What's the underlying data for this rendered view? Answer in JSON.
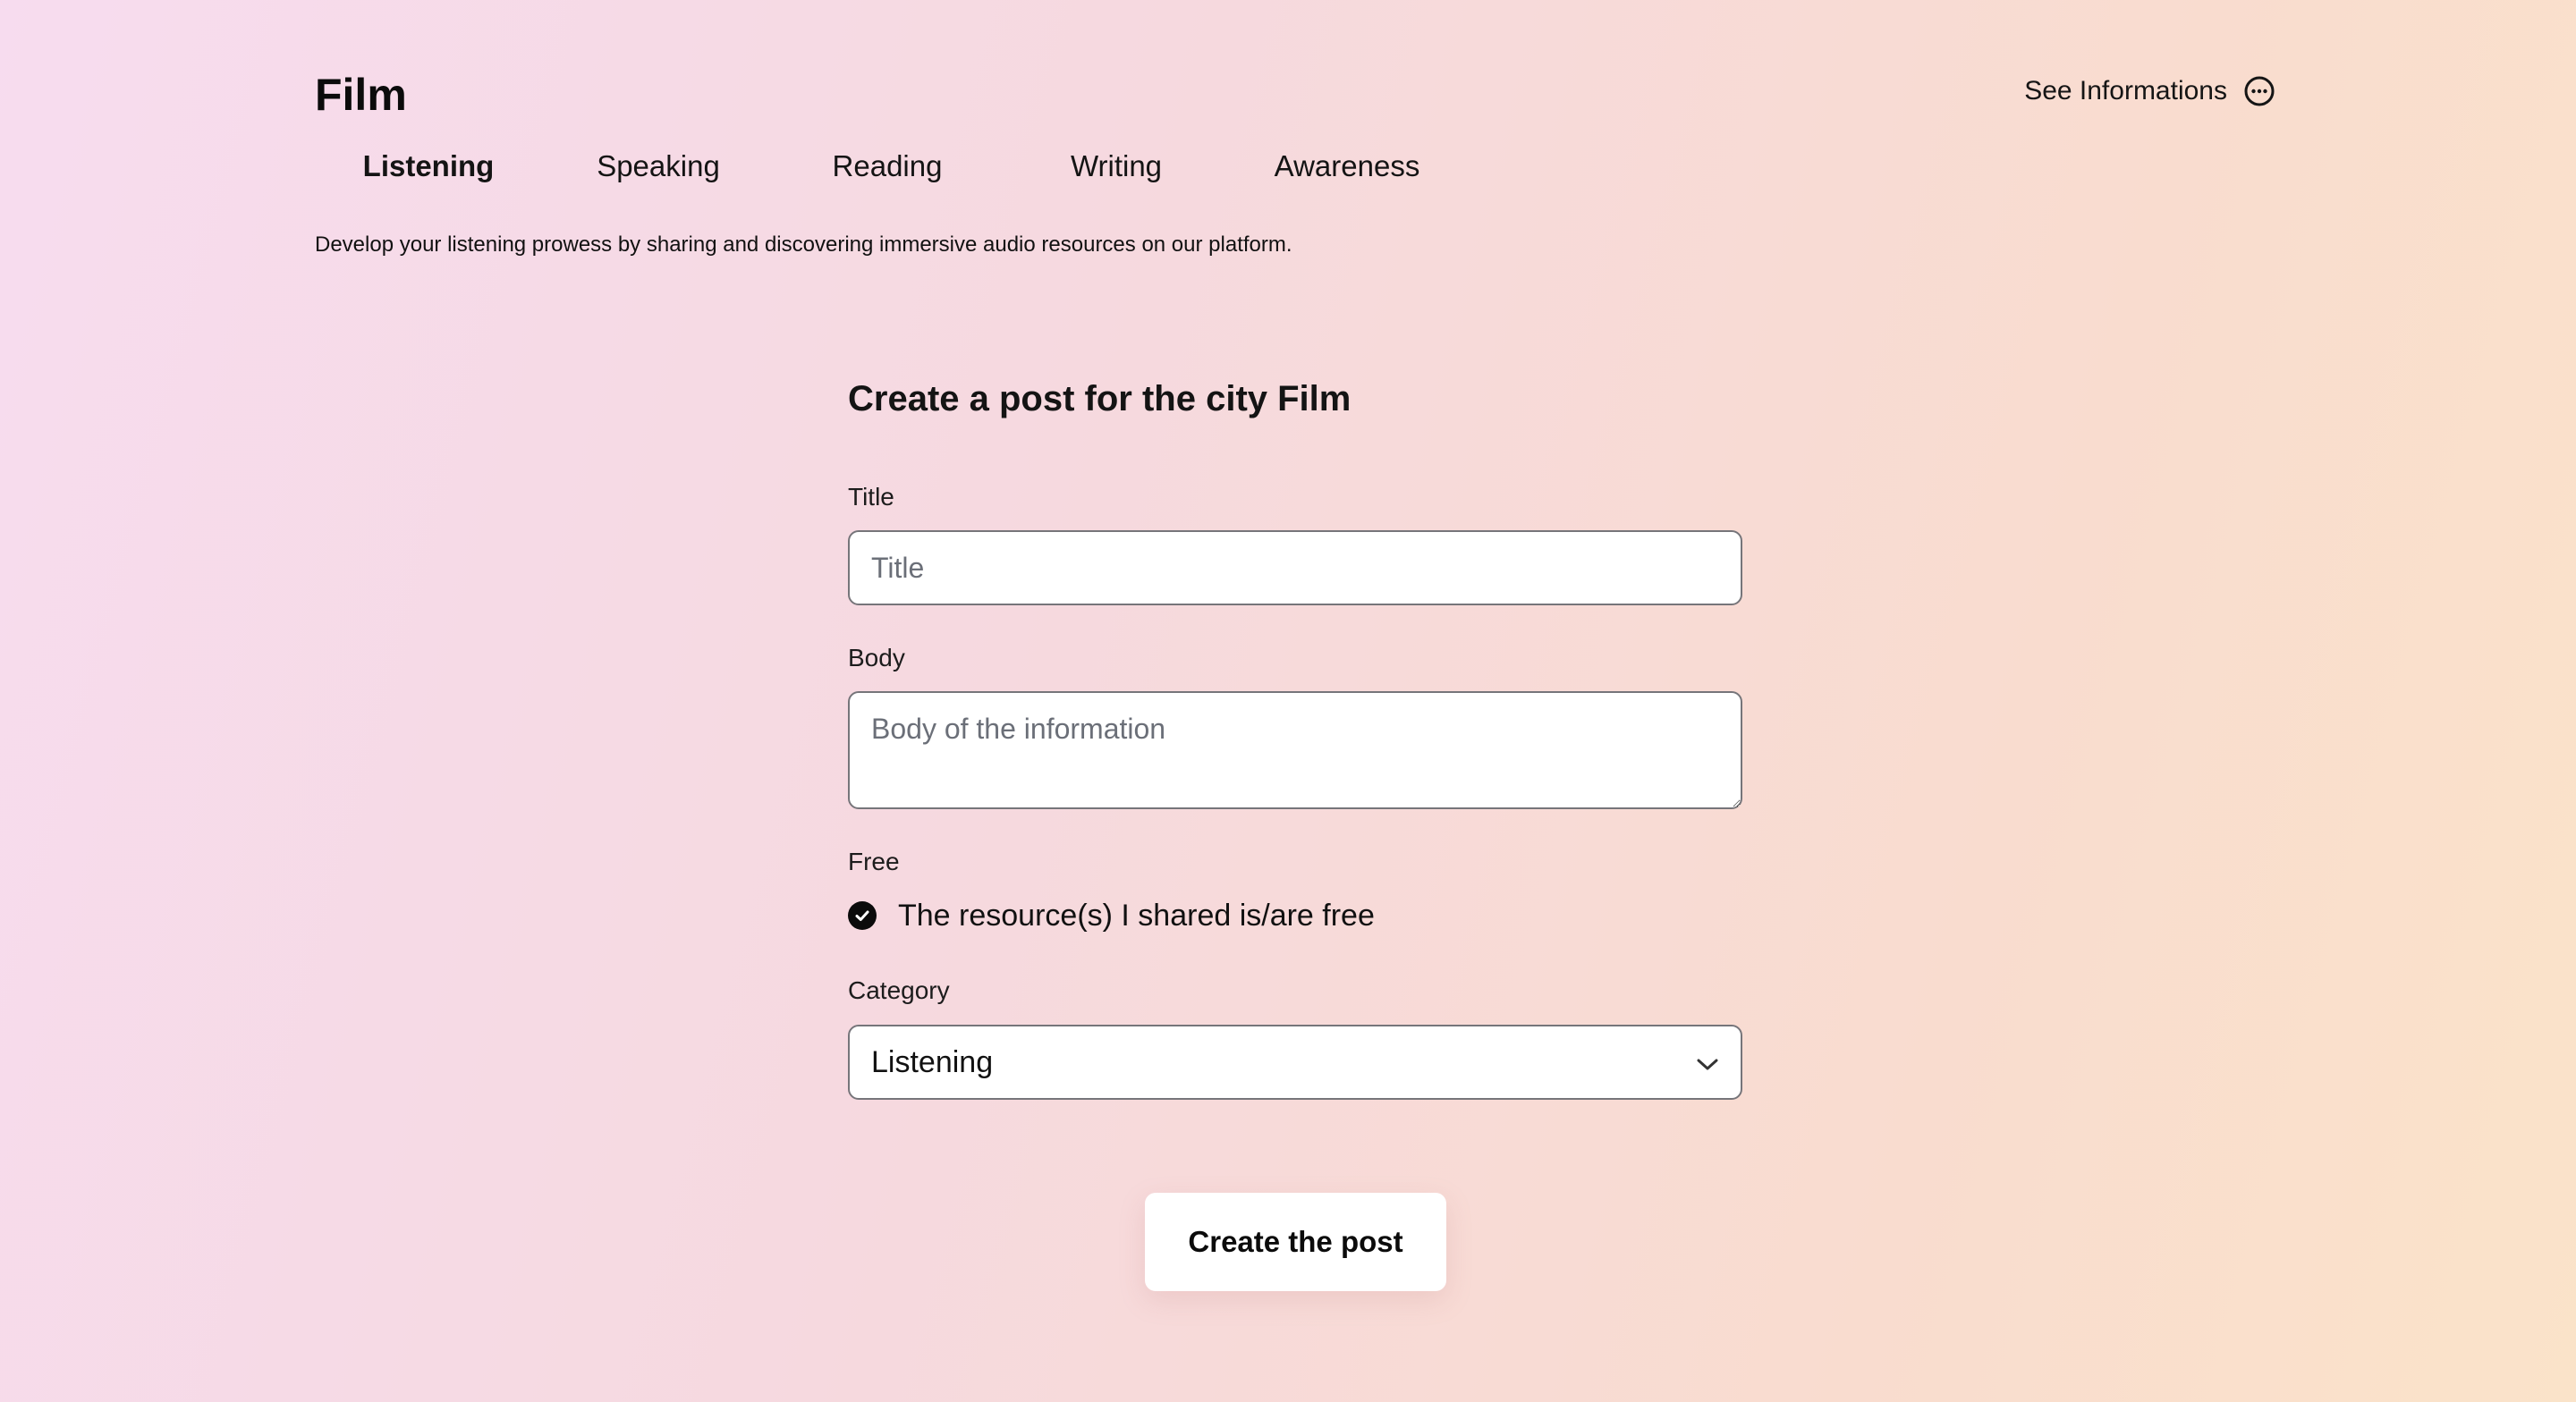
{
  "header": {
    "title": "Film",
    "info_link": {
      "label": "See Informations",
      "icon": "more-circle-icon"
    }
  },
  "tabs": [
    {
      "label": "Listening",
      "active": true
    },
    {
      "label": "Speaking",
      "active": false
    },
    {
      "label": "Reading",
      "active": false
    },
    {
      "label": "Writing",
      "active": false
    },
    {
      "label": "Awareness",
      "active": false
    }
  ],
  "tagline": "Develop your listening prowess by sharing and discovering immersive audio resources on our platform.",
  "form": {
    "heading": "Create a post for the city Film",
    "title_field": {
      "label": "Title",
      "value": "",
      "placeholder": "Title"
    },
    "body_field": {
      "label": "Body",
      "value": "",
      "placeholder": "Body of the information"
    },
    "free_field": {
      "label": "Free",
      "checked": true,
      "checkbox_label": "The resource(s) I shared is/are free",
      "icon": "check-circle-icon"
    },
    "category_field": {
      "label": "Category",
      "selected": "Listening",
      "icon": "chevron-down-icon"
    },
    "submit_label": "Create the post"
  },
  "colors": {
    "text": "#111111",
    "input_border": "#76757a",
    "input_background": "#ffffff",
    "placeholder": "#6b6f78",
    "gradient_start": "#f7dcef",
    "gradient_end": "#fae3c9"
  }
}
